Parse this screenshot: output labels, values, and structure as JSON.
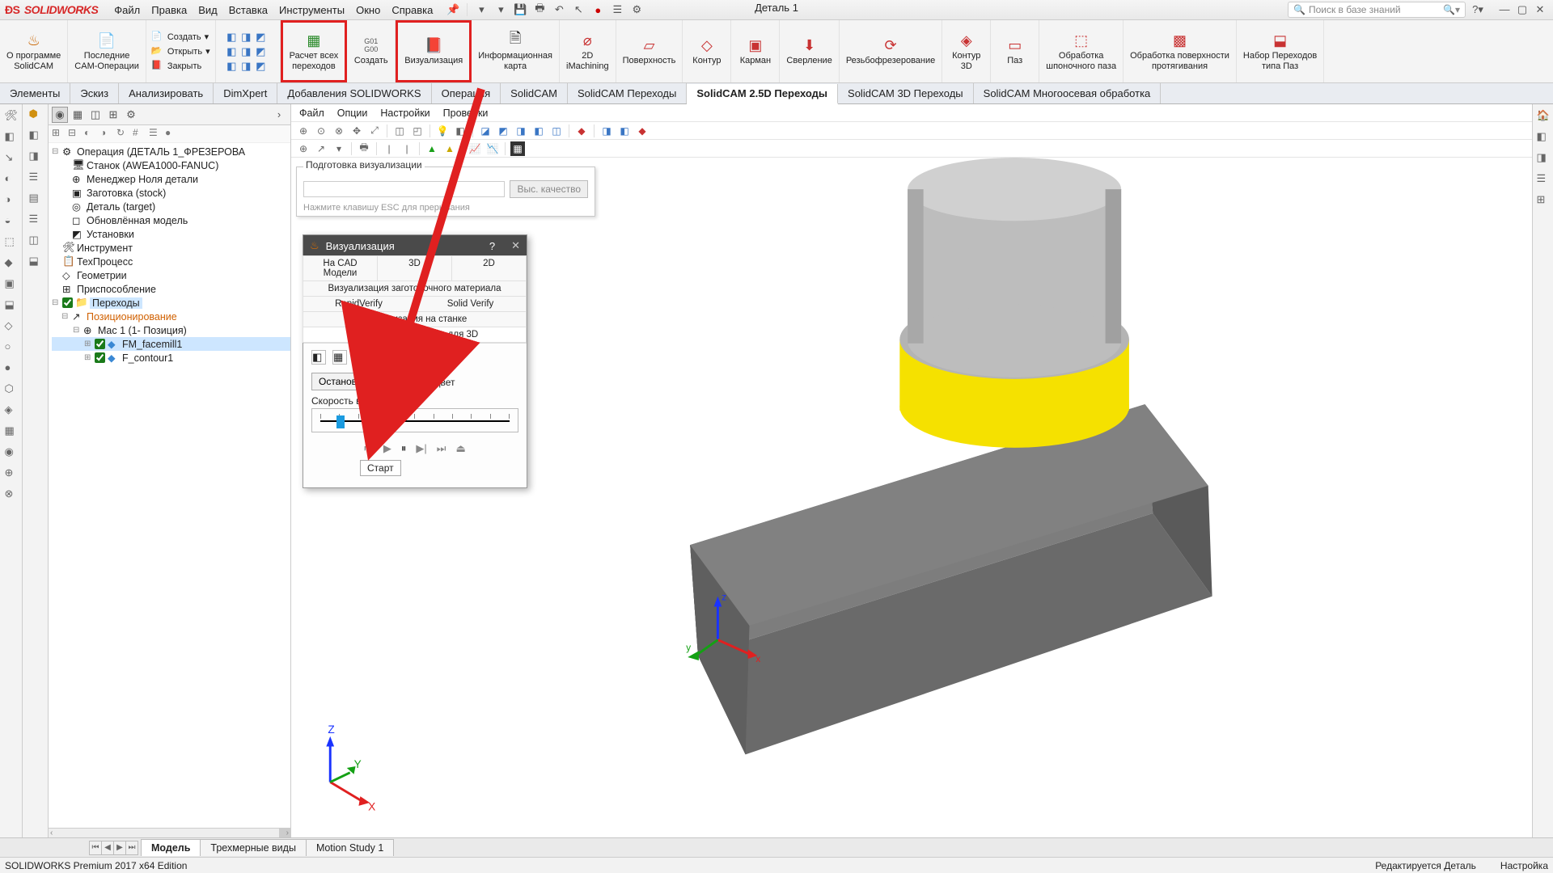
{
  "title": {
    "app": "SOLIDWORKS",
    "doc": "Деталь 1"
  },
  "menus": [
    "Файл",
    "Правка",
    "Вид",
    "Вставка",
    "Инструменты",
    "Окно",
    "Справка"
  ],
  "search": {
    "placeholder": "Поиск в базе знаний"
  },
  "ribbon": {
    "g0": {
      "lbl": "О программе\nSolidCAM"
    },
    "g1": {
      "lbl": "Последние\nCAM-Операции"
    },
    "file": {
      "new": "Создать",
      "open": "Открыть",
      "close": "Закрыть"
    },
    "calc": {
      "lbl": "Расчет всех\nпереходов"
    },
    "gcode": {
      "lbl": "Создать"
    },
    "viz": {
      "lbl": "Визуализация"
    },
    "infocard": {
      "lbl": "Информационная\nкарта"
    },
    "imach": {
      "lbl": "2D\niMachining"
    },
    "surface": {
      "lbl": "Поверхность"
    },
    "contour": {
      "lbl": "Контур"
    },
    "pocket": {
      "lbl": "Карман"
    },
    "drill": {
      "lbl": "Сверление"
    },
    "thread": {
      "lbl": "Резьбофрезерование"
    },
    "contour3d": {
      "lbl": "Контур\n3D"
    },
    "slot": {
      "lbl": "Паз"
    },
    "keyway": {
      "lbl": "Обработка\nшпоночного паза"
    },
    "broach": {
      "lbl": "Обработка поверхности\nпротягивания"
    },
    "slotset": {
      "lbl": "Набор Переходов\nтипа Паз"
    }
  },
  "tabs": [
    "Элементы",
    "Эскиз",
    "Анализировать",
    "DimXpert",
    "Добавления SOLIDWORKS",
    "Операция",
    "SolidCAM",
    "SolidCAM Переходы",
    "SolidCAM 2.5D Переходы",
    "SolidCAM 3D Переходы",
    "SolidCAM Многоосевая обработка"
  ],
  "activeTab": "SolidCAM 2.5D Переходы",
  "tree": {
    "root": "Операция (ДЕТАЛЬ 1_ФРЕЗЕРОВА",
    "machine": "Станок (AWEA1000-FANUC)",
    "zero": "Менеджер Ноля детали",
    "stock": "Заготовка (stock)",
    "target": "Деталь (target)",
    "updated": "Обновлённая модель",
    "setups": "Установки",
    "tool": "Инструмент",
    "process": "ТехПроцесс",
    "geom": "Геометрии",
    "fixture": "Приспособление",
    "transitions": "Переходы",
    "positioning": "Позиционирование",
    "mac": "Mac 1 (1- Позиция)",
    "op1": "FM_facemill1",
    "op2": "F_contour1"
  },
  "canvasMenu": [
    "Файл",
    "Опции",
    "Настройки",
    "Проверки"
  ],
  "prep": {
    "legend": "Подготовка визуализации",
    "btn": "Выс. качество",
    "note": "Нажмите клавишу ESC для прерывания"
  },
  "viz": {
    "title": "Визуализация",
    "help": "?",
    "tabs": [
      "На CAD Модели",
      "3D",
      "2D",
      "Визуализация заготовочного материала",
      "RapidVerify",
      "Solid Verify",
      "Визуализация на станке",
      "Объемная симуляция для 3D"
    ],
    "stop": "Остановить...",
    "oneColor": "Один цвет",
    "speed": "Скорость визуализации",
    "start": "Старт"
  },
  "bottomTabs": [
    "Модель",
    "Трехмерные виды",
    "Motion Study 1"
  ],
  "status": {
    "left": "SOLIDWORKS Premium 2017 x64 Edition",
    "mode": "Редактируется Деталь",
    "custom": "Настройка"
  }
}
